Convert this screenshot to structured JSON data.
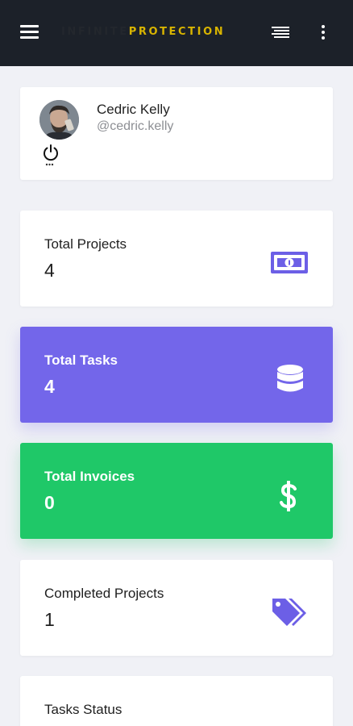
{
  "header": {
    "brand_part1": "INFINITE",
    "brand_part2": "PROTECTION",
    "colors": {
      "bar": "#1c2129",
      "brand_accent": "#d8b400"
    }
  },
  "profile": {
    "name": "Cedric Kelly",
    "username": "@cedric.kelly",
    "avatar_icon": "user-avatar",
    "logout_icon": "power-icon"
  },
  "stats": [
    {
      "label": "Total Projects",
      "value": "4",
      "icon": "money-bill-icon",
      "color": "#ffffff"
    },
    {
      "label": "Total Tasks",
      "value": "4",
      "icon": "database-icon",
      "color": "#7366ea"
    },
    {
      "label": "Total Invoices",
      "value": "0",
      "icon": "dollar-icon",
      "color": "#1fc868"
    },
    {
      "label": "Completed Projects",
      "value": "1",
      "icon": "tags-icon",
      "color": "#ffffff"
    }
  ],
  "tasks_status": {
    "title": "Tasks Status"
  },
  "accent": "#7366ea"
}
